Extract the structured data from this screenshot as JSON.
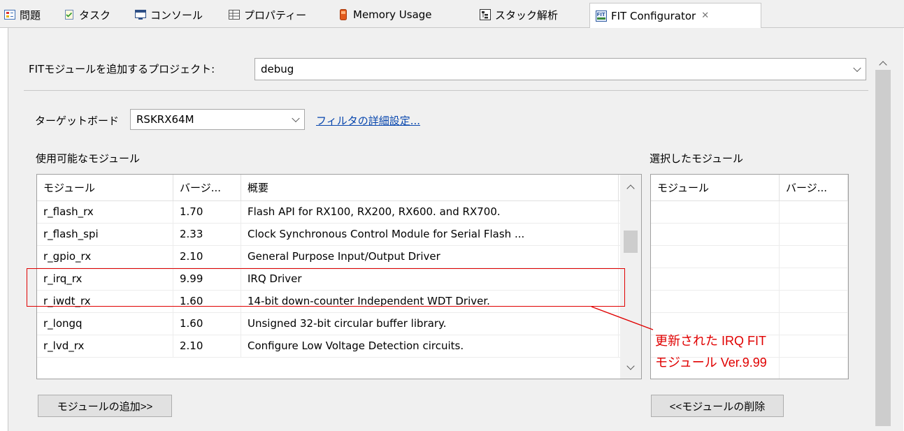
{
  "tabs": [
    {
      "label": "問題",
      "icon": "problems-icon"
    },
    {
      "label": "タスク",
      "icon": "tasks-icon"
    },
    {
      "label": "コンソール",
      "icon": "console-icon"
    },
    {
      "label": "プロパティー",
      "icon": "properties-icon"
    },
    {
      "label": "Memory Usage",
      "icon": "memory-usage-icon"
    },
    {
      "label": "スタック解析",
      "icon": "stack-analysis-icon"
    },
    {
      "label": "FIT Configurator",
      "icon": "fit-icon",
      "active": true
    }
  ],
  "project": {
    "label": "FITモジュールを追加するプロジェクト:",
    "value": "debug"
  },
  "board": {
    "label": "ターゲットボード",
    "value": "RSKRX64M",
    "filter_link": "フィルタの詳細設定..."
  },
  "available": {
    "title": "使用可能なモジュール",
    "columns": [
      "モジュール",
      "バージ...",
      "概要"
    ],
    "rows": [
      {
        "module": "r_flash_rx",
        "version": "1.70",
        "summary": "Flash API for RX100, RX200, RX600. and RX700."
      },
      {
        "module": "r_flash_spi",
        "version": "2.33",
        "summary": "Clock Synchronous Control Module for Serial Flash ..."
      },
      {
        "module": "r_gpio_rx",
        "version": "2.10",
        "summary": "General Purpose Input/Output Driver"
      },
      {
        "module": "r_irq_rx",
        "version": "9.99",
        "summary": "IRQ Driver"
      },
      {
        "module": "r_iwdt_rx",
        "version": "1.60",
        "summary": "14-bit down-counter Independent WDT Driver."
      },
      {
        "module": "r_longq",
        "version": "1.60",
        "summary": "Unsigned 32-bit circular buffer library."
      },
      {
        "module": "r_lvd_rx",
        "version": "2.10",
        "summary": "Configure Low Voltage Detection circuits."
      }
    ],
    "add_button": "モジュールの追加>>"
  },
  "selected": {
    "title": "選択したモジュール",
    "columns": [
      "モジュール",
      "バージ..."
    ],
    "remove_button": "<<モジュールの削除"
  },
  "annotation": {
    "line1": "更新された IRQ FIT",
    "line2": "モジュール Ver.9.99",
    "color": "#e00000"
  }
}
